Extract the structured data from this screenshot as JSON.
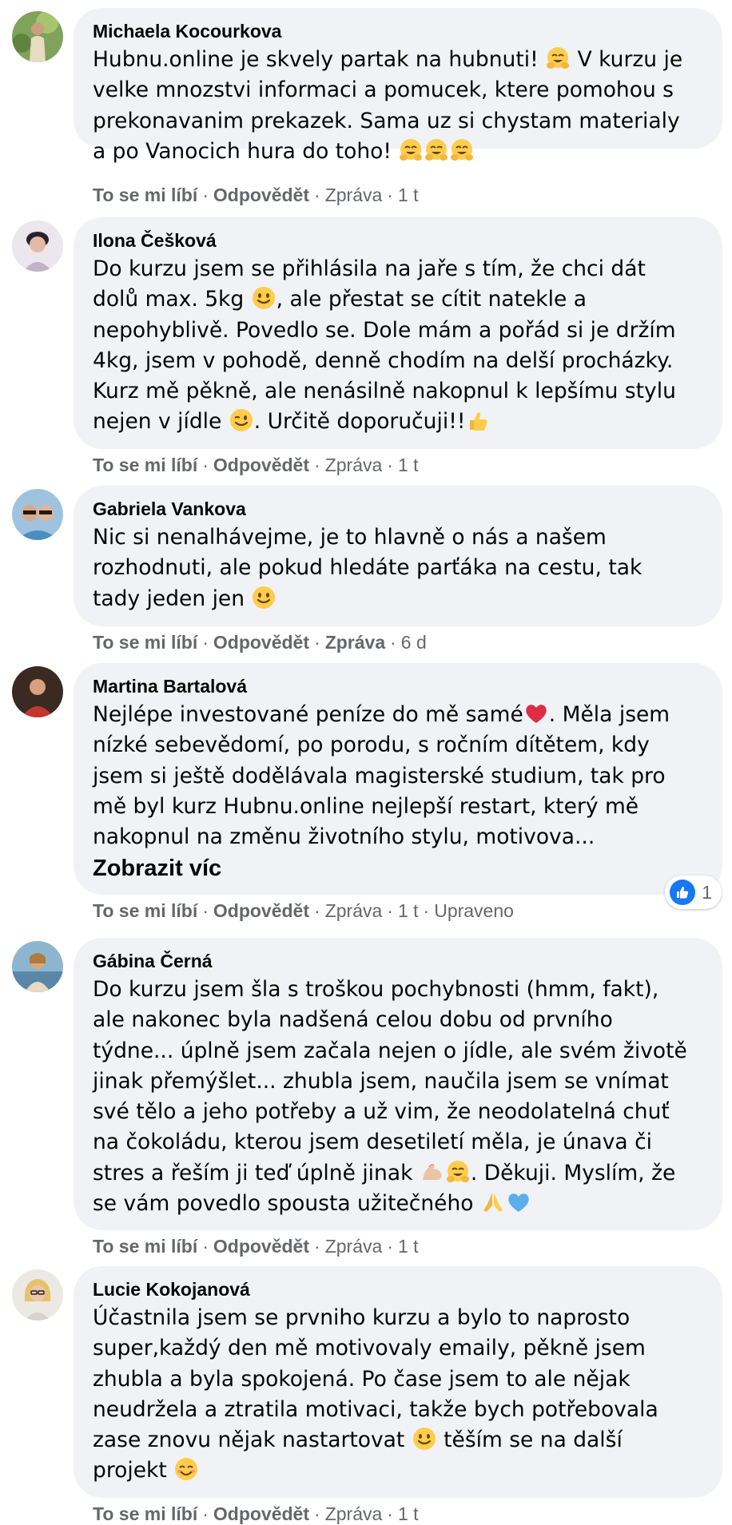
{
  "actions": {
    "like": "To se mi líbí",
    "reply": "Odpovědět",
    "message": "Zpráva"
  },
  "comments": [
    {
      "author": "Michaela Kocourkova",
      "lines": [
        "Hubnu.online je skvely partak na hubnuti!",
        "velke mnozstvi informaci a pomucek, ktere pomohou s",
        "prekonavanim prekazek. Sama uz si chystam materialy",
        "a po Vanocich hura do toho!"
      ],
      "line1_after_emoji": " V kurzu je",
      "time": "1 t",
      "emojis": [
        "hugging-face",
        "hugging-face",
        "hugging-face",
        "hugging-face"
      ]
    },
    {
      "author": "Ilona Češková",
      "lines": [
        "Do kurzu jsem se přihlásila na jaře s tím, že chci dát",
        "dolů max. 5kg",
        ", ale přestat se cítit natekle a",
        "nepohyblivě. Povedlo se. Dole mám a pořád si je držím",
        "4kg, jsem v pohodě, denně chodím na delší procházky.",
        "Kurz mě pěkně, ale nenásilně nakopnul k lepšímu stylu",
        "nejen v jídle",
        ". Určitě doporučuji!!"
      ],
      "time": "1 t",
      "emojis": [
        "slightly-smiling-face",
        "winking-face",
        "thumbs-up"
      ]
    },
    {
      "author": "Gabriela Vankova",
      "lines": [
        "Nic si nenalhávejme, je to hlavně o nás a našem",
        "rozhodnuti, ale pokud hledáte parťáka na cestu, tak",
        "tady jeden jen"
      ],
      "time": "6 d",
      "emojis": [
        "slightly-smiling-face"
      ]
    },
    {
      "author": "Martina Bartalová",
      "lines": [
        "Nejlépe investované peníze do mě samé",
        ". Měla jsem",
        "nízké sebevědomí, po porodu, s ročním dítětem, kdy",
        "jsem si ještě dodělávala magisterské studium, tak pro",
        "mě byl kurz Hubnu.online nejlepší restart, který mě",
        "nakopnul na změnu životního stylu, motivova..."
      ],
      "see_more": "Zobrazit víc",
      "time": "1 t",
      "edited": "Upraveno",
      "reaction_count": "1",
      "emojis": [
        "red-heart",
        "like-reaction"
      ]
    },
    {
      "author": "Gábina Černá",
      "lines": [
        "Do kurzu jsem šla s troškou pochybnosti (hmm, fakt),",
        "ale nakonec byla nadšená celou dobu od prvního",
        "týdne... úplně jsem začala nejen o jídle, ale svém životě",
        "jinak přemýšlet... zhubla jsem, naučila jsem se vnímat",
        "své tělo a jeho potřeby a už vim, že neodolatelná chuť",
        "na čokoládu, kterou jsem desetiletí měla, je únava či",
        "stres a řeším ji teď úplně jinak",
        ". Děkuji. Myslím, že",
        "se vám povedlo spousta užitečného"
      ],
      "time": "1 t",
      "emojis": [
        "flexed-biceps",
        "hugging-face",
        "folded-hands",
        "blue-heart"
      ]
    },
    {
      "author": "Lucie Kokojanová",
      "lines": [
        "Účastnila jsem se prvniho kurzu a bylo to naprosto",
        "super,každý den mě motivovaly emaily, pěkně jsem",
        "zhubla a byla spokojená. Po čase jsem to ale nějak",
        "neudržela a ztratila motivaci, takže bych potřebovala",
        "zase znovu nějak nastartovat",
        "těším se na další",
        "projekt"
      ],
      "time": "1 t",
      "emojis": [
        "slightly-smiling-face",
        "smiling-face-with-smiling-eyes"
      ]
    }
  ],
  "colors": {
    "bubble": "#f0f2f5",
    "meta": "#65676b",
    "text": "#050505",
    "like_blue": "#1877f2"
  }
}
